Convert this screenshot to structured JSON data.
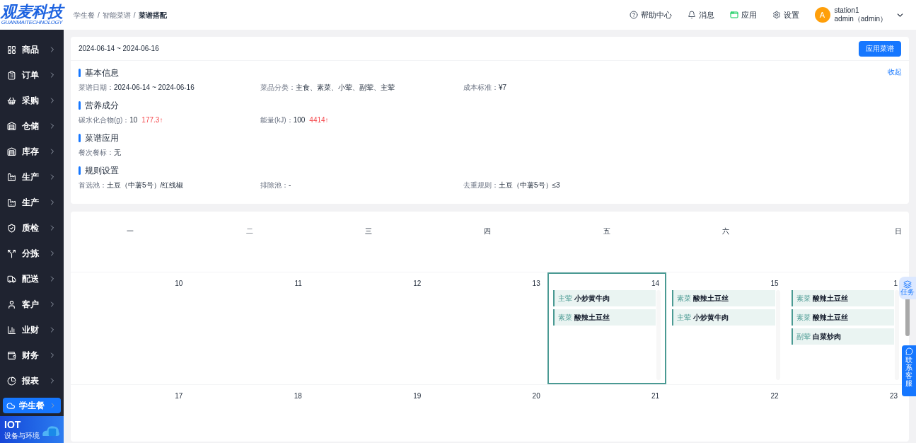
{
  "logo": {
    "title": "观麦科技",
    "subtitle": "GUANMAITECHNOLOGY"
  },
  "breadcrumb_separator": "/",
  "breadcrumb": [
    {
      "label": "学生餐",
      "current": false
    },
    {
      "label": "智能菜谱",
      "current": false
    },
    {
      "label": "菜谱搭配",
      "current": true
    }
  ],
  "header_actions": [
    {
      "kind": "help",
      "label": "帮助中心"
    },
    {
      "kind": "bell",
      "label": "消息"
    },
    {
      "kind": "app",
      "label": "应用"
    },
    {
      "kind": "gear",
      "label": "设置"
    }
  ],
  "user": {
    "avatar": "A",
    "station": "station1",
    "name": "admin（admin）"
  },
  "sidebar": {
    "items": [
      {
        "kind": "grid",
        "label": "商品",
        "selected": false
      },
      {
        "kind": "clipboard",
        "label": "订单",
        "selected": false
      },
      {
        "kind": "basket",
        "label": "采购",
        "selected": false
      },
      {
        "kind": "house",
        "label": "仓储",
        "selected": false
      },
      {
        "kind": "house",
        "label": "库存",
        "selected": false
      },
      {
        "kind": "factory",
        "label": "生产",
        "selected": false
      },
      {
        "kind": "factory",
        "label": "生产",
        "selected": false
      },
      {
        "kind": "shield",
        "label": "质检",
        "selected": false
      },
      {
        "kind": "split",
        "label": "分拣",
        "selected": false
      },
      {
        "kind": "truck",
        "label": "配送",
        "selected": false
      },
      {
        "kind": "user",
        "label": "客户",
        "selected": false
      },
      {
        "kind": "chart",
        "label": "业财",
        "selected": false
      },
      {
        "kind": "wallet",
        "label": "财务",
        "selected": false
      },
      {
        "kind": "pie",
        "label": "报表",
        "selected": false
      },
      {
        "kind": "cloud",
        "label": "学生餐",
        "selected": true
      }
    ],
    "promo": {
      "title": "IOT",
      "subtitle": "设备与环境"
    }
  },
  "toolbar": {
    "date_range": "2024-06-14 ~ 2024-06-16",
    "apply_button": "应用菜谱"
  },
  "collapse_link": "收起",
  "sections": [
    {
      "title": "基本信息",
      "fields": [
        {
          "label": "菜谱日期：",
          "value": "2024-06-14 ~ 2024-06-16"
        },
        {
          "label": "菜品分类：",
          "value": "主食、素菜、小荤、副荤、主荤"
        },
        {
          "label": "成本标准：",
          "value": "¥7"
        }
      ]
    },
    {
      "title": "营养成分",
      "fields": [
        {
          "label": "碳水化合物(g)：",
          "value": "10",
          "warning": "177.3↑"
        },
        {
          "label": "能量(kJ)：",
          "value": "100",
          "warning": "4414↑"
        }
      ]
    },
    {
      "title": "菜谱应用",
      "fields": [
        {
          "label": "餐次餐标：",
          "value": "无"
        }
      ]
    },
    {
      "title": "规则设置",
      "fields": [
        {
          "label": "首选池：",
          "value": "土豆（中薯5号）/红线椒"
        },
        {
          "label": "排除池：",
          "value": "-"
        },
        {
          "label": "去重规则：",
          "value": "土豆（中薯5号）≤3"
        }
      ]
    }
  ],
  "calendar": {
    "weekdays": [
      "一",
      "二",
      "三",
      "四",
      "五",
      "六",
      "日"
    ],
    "weeks": [
      {
        "days": [
          {
            "date": "10",
            "selected": false
          },
          {
            "date": "11",
            "selected": false
          },
          {
            "date": "12",
            "selected": false
          },
          {
            "date": "13",
            "selected": false
          },
          {
            "date": "14",
            "selected": true,
            "events": [
              {
                "category": "主荤",
                "name": "小炒黄牛肉"
              },
              {
                "category": "素菜",
                "name": "酸辣土豆丝"
              }
            ]
          },
          {
            "date": "15",
            "selected": false,
            "events": [
              {
                "category": "素菜",
                "name": "酸辣土豆丝"
              },
              {
                "category": "主荤",
                "name": "小炒黄牛肉"
              }
            ]
          },
          {
            "date": "1",
            "selected": false,
            "events": [
              {
                "category": "素菜",
                "name": "酸辣土豆丝"
              },
              {
                "category": "素菜",
                "name": "酸辣土豆丝"
              },
              {
                "category": "副荤",
                "name": "白菜炒肉"
              }
            ]
          }
        ]
      },
      {
        "days": [
          {
            "date": "17",
            "selected": false
          },
          {
            "date": "18",
            "selected": false
          },
          {
            "date": "19",
            "selected": false
          },
          {
            "date": "20",
            "selected": false
          },
          {
            "date": "21",
            "selected": false
          },
          {
            "date": "22",
            "selected": false
          },
          {
            "date": "23",
            "selected": false
          }
        ]
      }
    ]
  },
  "float_buttons": {
    "task": "任务",
    "support": "联系客服"
  }
}
